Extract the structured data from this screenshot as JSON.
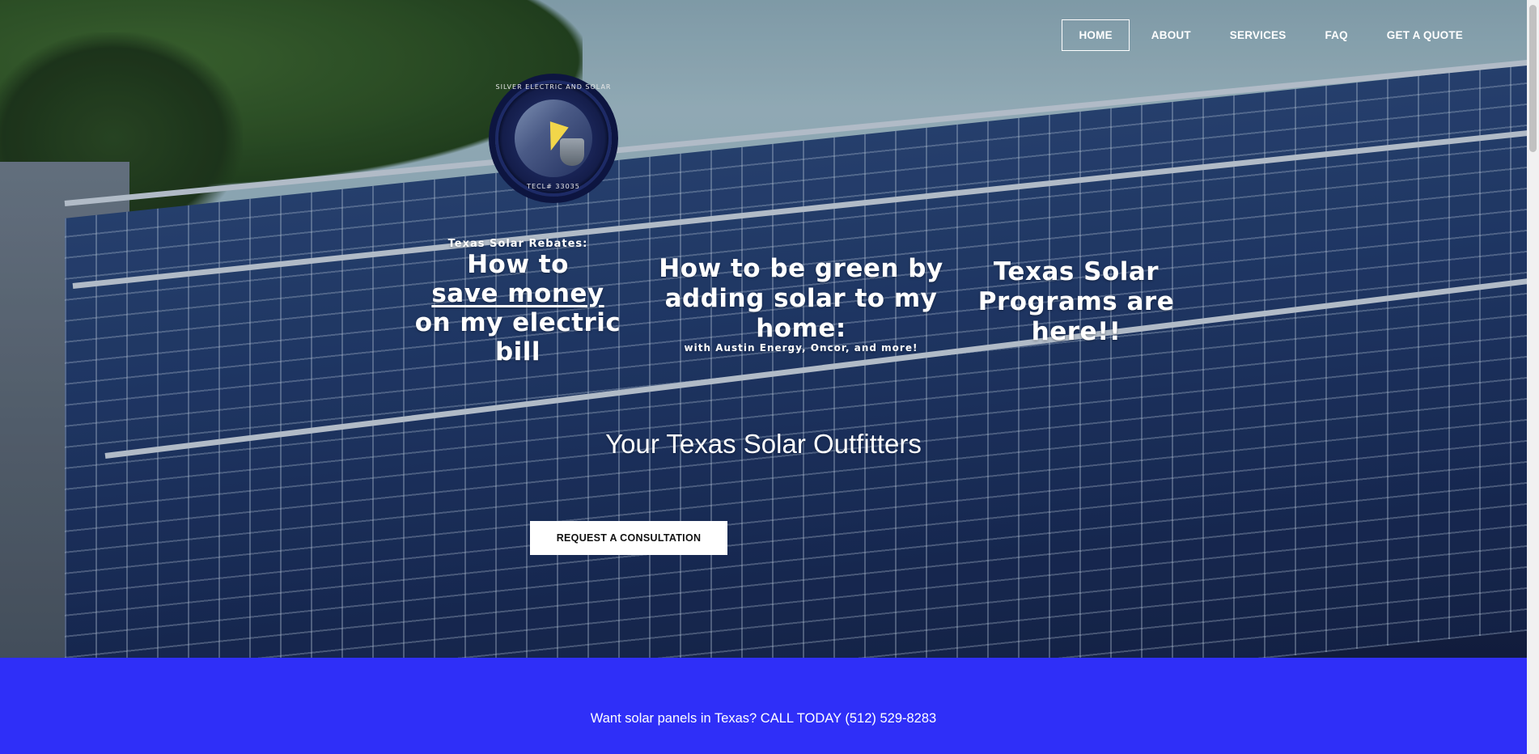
{
  "nav": {
    "items": [
      {
        "label": "HOME"
      },
      {
        "label": "ABOUT"
      },
      {
        "label": "SERVICES"
      },
      {
        "label": "FAQ"
      },
      {
        "label": "GET A QUOTE"
      }
    ],
    "active_index": 0
  },
  "logo": {
    "top_text": "SILVER ELECTRIC AND SOLAR",
    "bottom_text": "TECL# 33035"
  },
  "headlines": {
    "block1": {
      "kicker": "Texas Solar Rebates:",
      "line1": "How to",
      "line2": "save money",
      "line3": "on my electric",
      "line4": "bill"
    },
    "block2": {
      "line1": "How to be green by",
      "line2": "adding solar to my",
      "line3": "home:",
      "sub": "with Austin Energy, Oncor, and more!"
    },
    "block3": {
      "line1": "Texas Solar",
      "line2": "Programs are",
      "line3": "here!!"
    }
  },
  "tagline": "Your Texas Solar Outfitters",
  "cta": {
    "label": "REQUEST A CONSULTATION"
  },
  "band": {
    "text": "Want solar panels in Texas? CALL TODAY (512) 529-8283"
  },
  "colors": {
    "band_bg": "#2f2ff8",
    "text": "#ffffff"
  }
}
